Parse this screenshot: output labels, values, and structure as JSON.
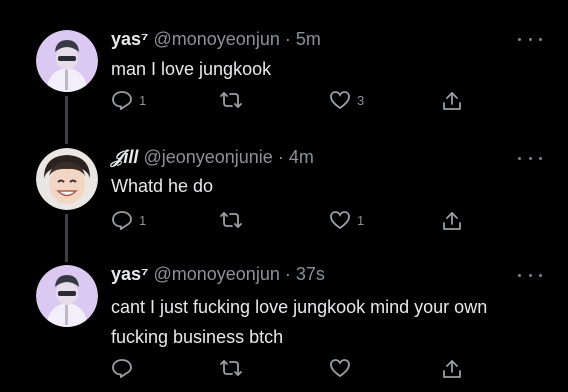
{
  "tweets": [
    {
      "name": "yas⁷",
      "handle": "@monoyeonjun",
      "separator": "·",
      "time": "5m",
      "text": "man I love jungkook",
      "reply_count": "1",
      "retweet_count": "",
      "like_count": "3"
    },
    {
      "name": "𝒥ill",
      "handle": "@jeonyeonjunie",
      "separator": "·",
      "time": "4m",
      "text": "Whatd he do",
      "reply_count": "1",
      "retweet_count": "",
      "like_count": "1"
    },
    {
      "name": "yas⁷",
      "handle": "@monoyeonjun",
      "separator": "·",
      "time": "37s",
      "text": "cant I just fucking love jungkook mind your own fucking business btch",
      "reply_count": "",
      "retweet_count": "",
      "like_count": ""
    }
  ],
  "icons": {
    "reply": "reply-icon",
    "retweet": "retweet-icon",
    "like": "heart-icon",
    "share": "share-icon",
    "more": "more-options-icon"
  },
  "colors": {
    "background": "#000000",
    "primary_text": "#e7e9ea",
    "secondary_text": "#8b9196",
    "avatar_purple": "#d9c6f0"
  }
}
